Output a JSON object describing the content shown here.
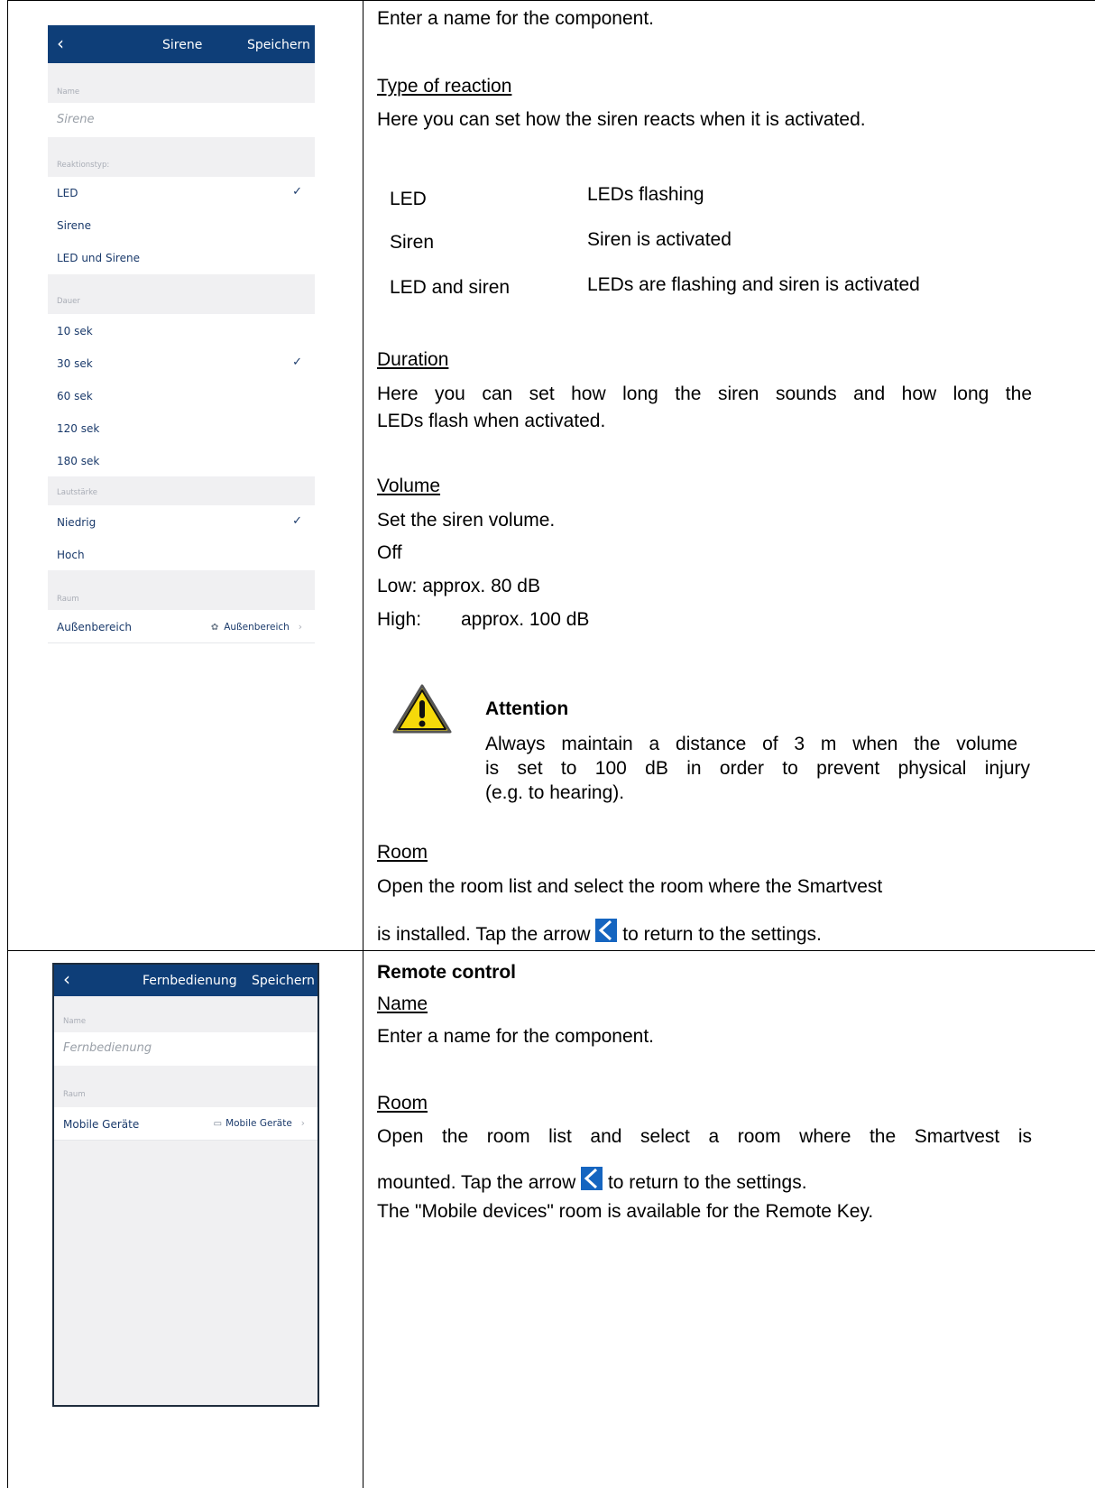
{
  "phone1": {
    "header": {
      "back_icon": "chevron-left-icon",
      "title": "Sirene",
      "save": "Speichern"
    },
    "name_label": "Name",
    "name_value": "Sirene",
    "reaction_label": "Reaktionstyp:",
    "reaction_options": [
      {
        "label": "LED",
        "selected": true
      },
      {
        "label": "Sirene",
        "selected": false
      },
      {
        "label": "LED und Sirene",
        "selected": false
      }
    ],
    "duration_label": "Dauer",
    "duration_options": [
      {
        "label": "10 sek",
        "selected": false
      },
      {
        "label": "30 sek",
        "selected": true
      },
      {
        "label": "60 sek",
        "selected": false
      },
      {
        "label": "120 sek",
        "selected": false
      },
      {
        "label": "180 sek",
        "selected": false
      }
    ],
    "volume_label": "Lautstärke",
    "volume_options": [
      {
        "label": "Niedrig",
        "selected": true
      },
      {
        "label": "Hoch",
        "selected": false
      }
    ],
    "room_label": "Raum",
    "room_row": {
      "label": "Außenbereich",
      "value": "Außenbereich",
      "icon": "tree-icon"
    },
    "check_glyph": "✓"
  },
  "phone2": {
    "header": {
      "back_icon": "chevron-left-icon",
      "title": "Fernbedienung",
      "save": "Speichern"
    },
    "name_label": "Name",
    "name_value": "Fernbedienung",
    "room_label": "Raum",
    "room_row": {
      "label": "Mobile Geräte",
      "value": "Mobile Geräte",
      "icon": "devices-icon"
    }
  },
  "text1": {
    "intro": "Enter a name for the component.",
    "reaction_heading": "Type of reaction",
    "reaction_desc": "Here you can set how the siren reacts when it is activated.",
    "reactions": [
      {
        "name": "LED",
        "desc": "LEDs flashing"
      },
      {
        "name": "Siren",
        "desc": "Siren is activated"
      },
      {
        "name": "LED and siren",
        "desc": "LEDs are flashing and siren is activated"
      }
    ],
    "duration_heading": "Duration",
    "duration_line1": "Here you can set how long the siren sounds and how long the",
    "duration_line2": "LEDs flash when activated.",
    "volume_heading": "Volume",
    "volume_desc": "Set the siren volume.",
    "volume_off": "Off",
    "volume_low": "Low:  approx. 80 dB",
    "volume_high_label": "High:",
    "volume_high_value": "approx. 100 dB",
    "attention_title": "Attention",
    "attention_line1": "Always maintain a distance of 3 m when the volume",
    "attention_line2": "is set to 100 dB in order to prevent physical injury",
    "attention_line3": "(e.g. to hearing).",
    "room_heading": "Room",
    "room_line1": "Open the room list and select the room where the Smartvest",
    "room_line2a": "is installed. Tap the arrow",
    "room_line2b": "to return to the settings."
  },
  "text2": {
    "title": "Remote control",
    "name_heading": "Name",
    "name_desc": "Enter a name for the component.",
    "room_heading": "Room",
    "room_line1": "Open the room list and select a room where the Smartvest is",
    "room_line2a": "mounted. Tap the arrow",
    "room_line2b": "to return to the settings.",
    "room_line3": "The \"Mobile devices\" room is available for the Remote Key."
  },
  "colors": {
    "header_blue": "#0e3e78",
    "link_blue": "#1a3a6b",
    "warning_yellow": "#f5d90a",
    "arrow_blue": "#1565c0"
  }
}
